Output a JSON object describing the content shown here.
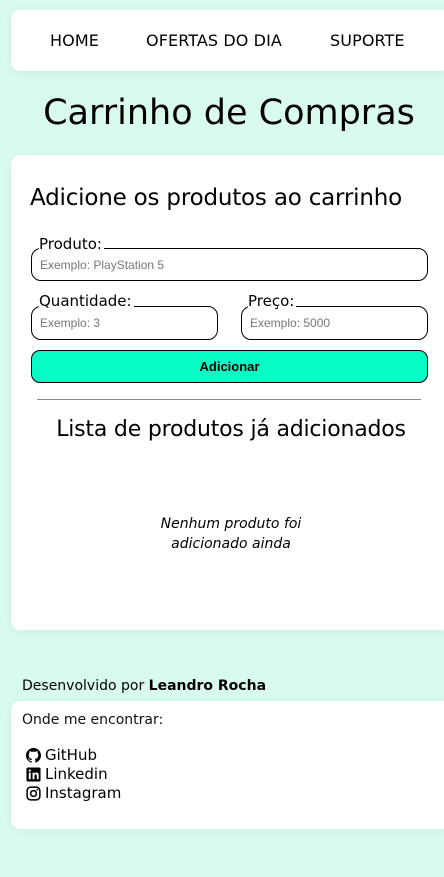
{
  "nav": {
    "items": [
      {
        "label": "HOME"
      },
      {
        "label": "OFERTAS DO DIA"
      },
      {
        "label": "SUPORTE"
      }
    ]
  },
  "page_title": "Carrinho de Compras",
  "form": {
    "title": "Adicione os produtos ao carrinho",
    "product": {
      "label": "Produto:",
      "placeholder": "Exemplo: PlayStation 5",
      "value": ""
    },
    "quantity": {
      "label": "Quantidade:",
      "placeholder": "Exemplo: 3",
      "value": ""
    },
    "price": {
      "label": "Preço:",
      "placeholder": "Exemplo: 5000",
      "value": ""
    },
    "add_button": "Adicionar"
  },
  "list": {
    "title": "Lista de produtos já adicionados",
    "empty_message": "Nenhum produto foi adicionado ainda"
  },
  "footer": {
    "developed_by": "Desenvolvido por",
    "author": "Leandro Rocha",
    "find_me": "Onde me encontrar:",
    "links": [
      {
        "label": "GitHub",
        "icon": "github-icon"
      },
      {
        "label": "Linkedin",
        "icon": "linkedin-icon"
      },
      {
        "label": "Instagram",
        "icon": "instagram-icon"
      }
    ]
  },
  "colors": {
    "background": "#d9fbee",
    "accent": "#06fcc3"
  }
}
